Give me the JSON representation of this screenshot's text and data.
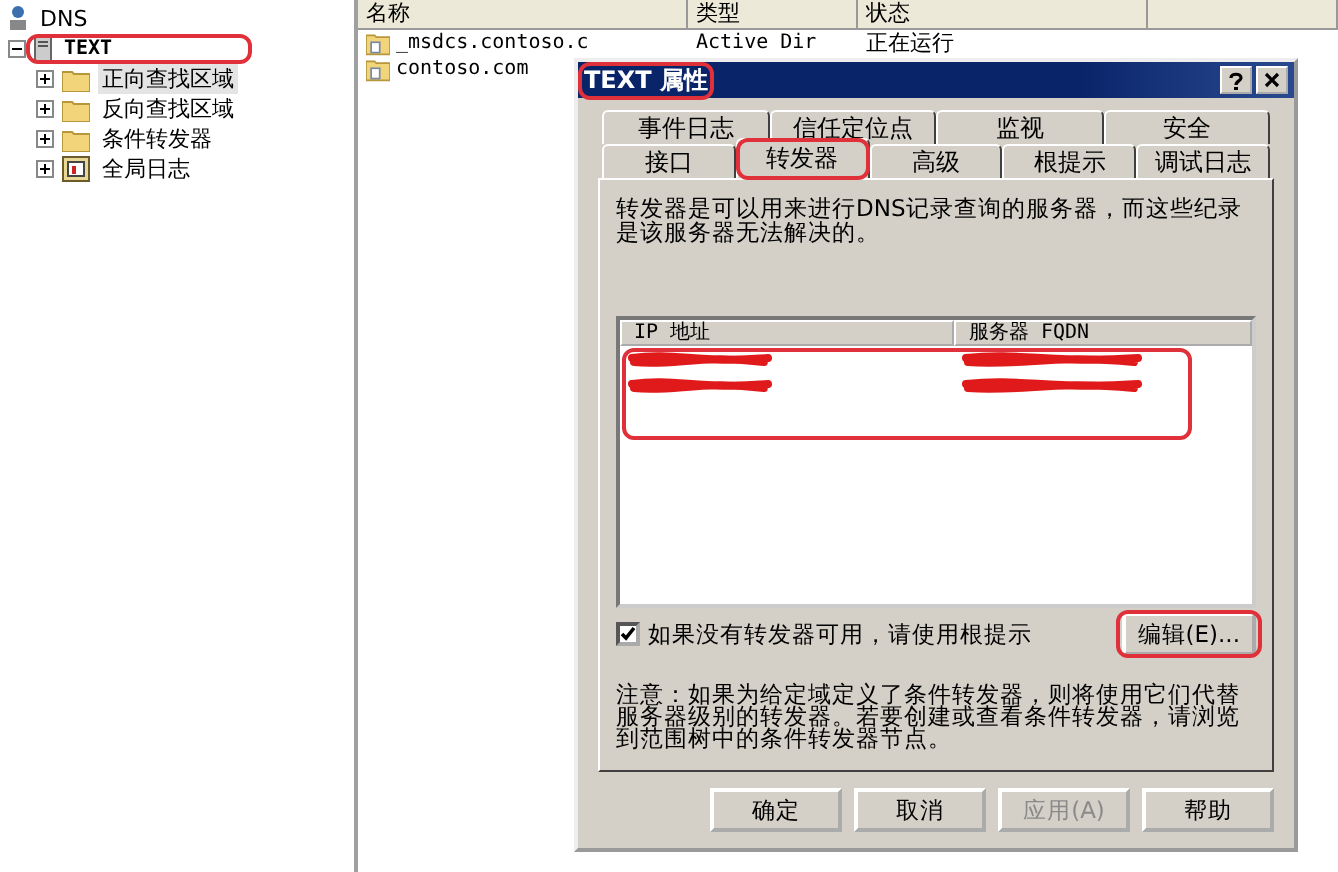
{
  "tree": {
    "label": "DNS",
    "children": [
      {
        "label": "TEXT",
        "expanded": true,
        "highlight": true,
        "children": [
          {
            "label": "正向查找区域",
            "kind": "folder",
            "expanded": false,
            "selected": true
          },
          {
            "label": "反向查找区域",
            "kind": "folder",
            "expanded": false,
            "selected": false
          },
          {
            "label": "条件转发器",
            "kind": "folder",
            "expanded": false,
            "selected": false
          },
          {
            "label": "全局日志",
            "kind": "log",
            "expanded": false,
            "selected": false
          }
        ]
      }
    ]
  },
  "list": {
    "columns": [
      "名称",
      "类型",
      "状态"
    ],
    "rows": [
      {
        "cells": [
          "_msdcs.contoso.c",
          "Active Dir",
          "正在运行"
        ]
      },
      {
        "cells": [
          "contoso.com"
        ]
      }
    ]
  },
  "dialog": {
    "title": "TEXT 属性",
    "title_highlight": true,
    "tab_rows": [
      [
        {
          "label": "事件日志",
          "selected": false
        },
        {
          "label": "信任定位点",
          "selected": false
        },
        {
          "label": "监视",
          "selected": false
        },
        {
          "label": "安全",
          "selected": false
        }
      ],
      [
        {
          "label": "接口",
          "selected": false
        },
        {
          "label": "转发器",
          "selected": true,
          "highlight": true
        },
        {
          "label": "高级",
          "selected": false
        },
        {
          "label": "根提示",
          "selected": false
        },
        {
          "label": "调试日志",
          "selected": false
        }
      ]
    ],
    "description": "转发器是可以用来进行DNS记录查询的服务器，而这些纪录是该服务器无法解决的。",
    "forwarders": {
      "columns": [
        "IP 地址",
        "服务器 FQDN"
      ],
      "highlight": true,
      "rows": [
        {
          "redacted": true
        },
        {
          "redacted": true
        }
      ]
    },
    "use_root_hints": {
      "label": "如果没有转发器可用，请使用根提示",
      "checked": true
    },
    "edit_button": {
      "label": "编辑(E)...",
      "highlight": true
    },
    "note": "注意：如果为给定域定义了条件转发器，则将使用它们代替服务器级别的转发器。若要创建或查看条件转发器，请浏览到范围树中的条件转发器节点。",
    "buttons": [
      {
        "label": "确定",
        "disabled": false
      },
      {
        "label": "取消",
        "disabled": false
      },
      {
        "label": "应用(A)",
        "disabled": true
      },
      {
        "label": "帮助",
        "disabled": false
      }
    ]
  }
}
